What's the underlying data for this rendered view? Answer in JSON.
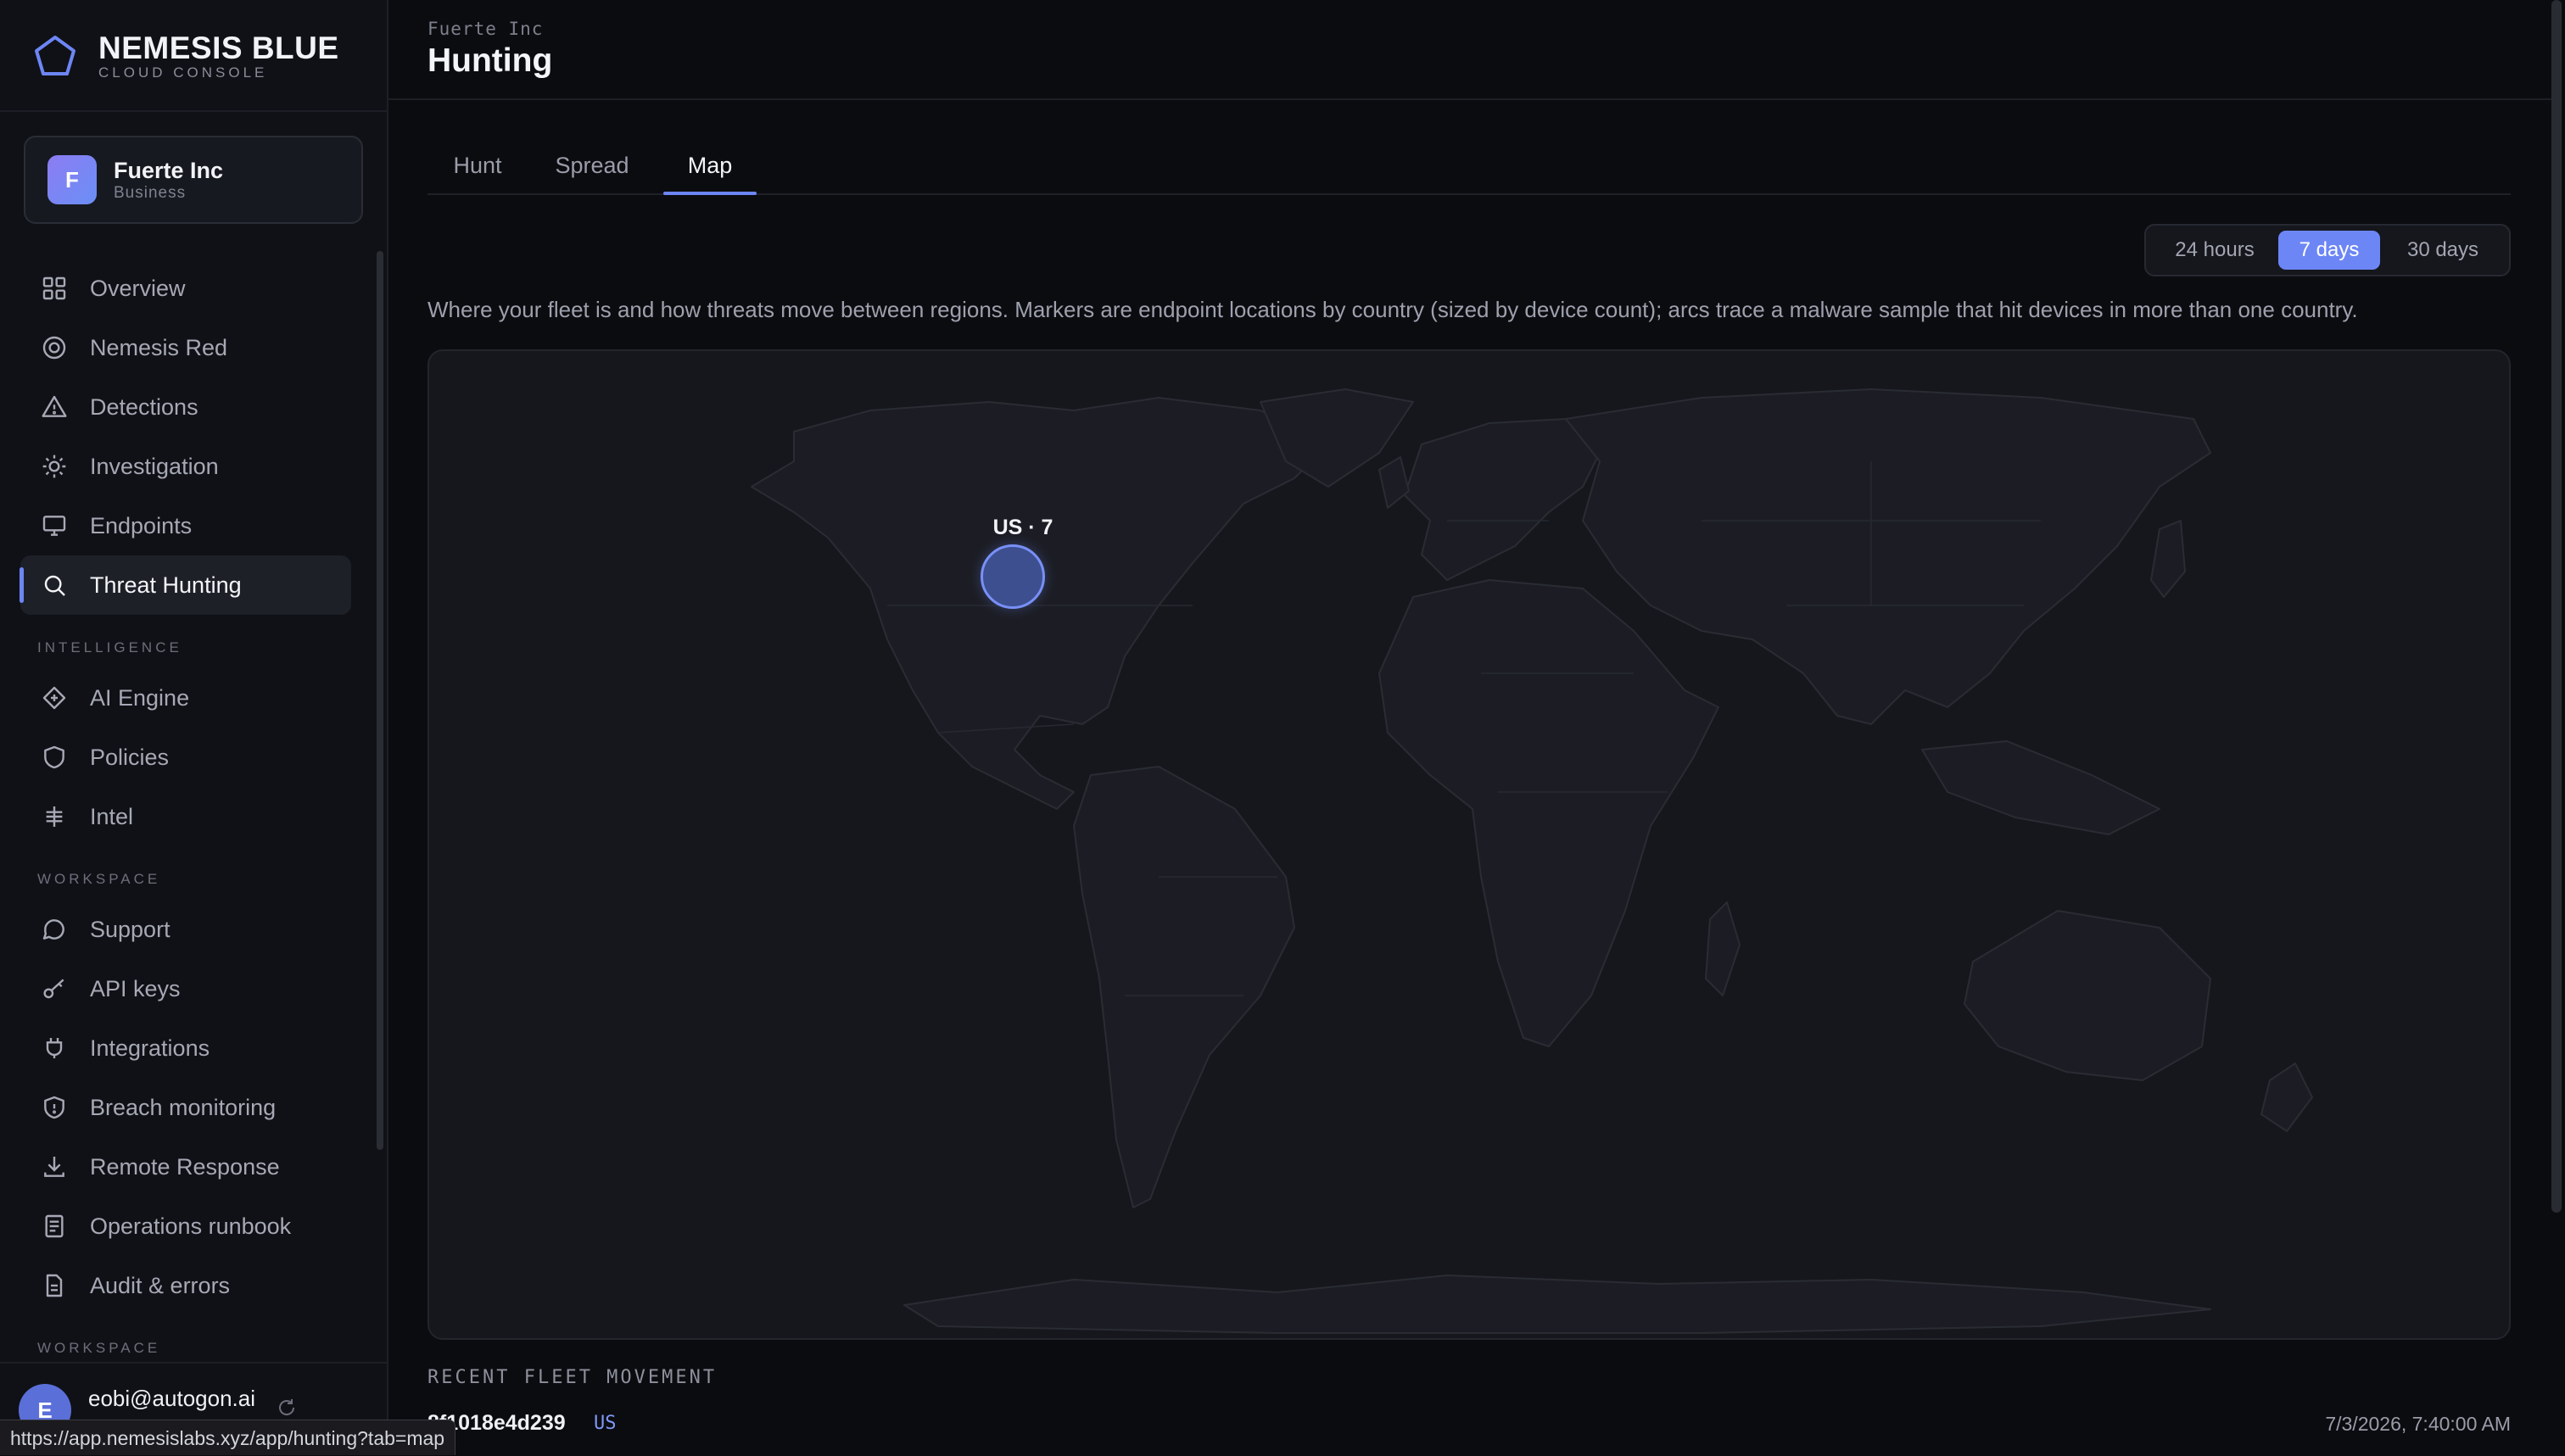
{
  "brand": {
    "name": "NEMESIS BLUE",
    "subtitle": "CLOUD CONSOLE"
  },
  "org": {
    "initial": "F",
    "name": "Fuerte Inc",
    "plan": "Business"
  },
  "nav": {
    "main": [
      {
        "label": "Overview",
        "icon": "grid-icon"
      },
      {
        "label": "Nemesis Red",
        "icon": "target-icon"
      },
      {
        "label": "Detections",
        "icon": "warning-triangle-icon"
      },
      {
        "label": "Investigation",
        "icon": "sun-bug-icon"
      },
      {
        "label": "Endpoints",
        "icon": "monitor-icon"
      },
      {
        "label": "Threat Hunting",
        "icon": "search-icon",
        "active": true
      }
    ],
    "intelligence_label": "INTELLIGENCE",
    "intelligence": [
      {
        "label": "AI Engine",
        "icon": "diamond-icon"
      },
      {
        "label": "Policies",
        "icon": "shield-icon"
      },
      {
        "label": "Intel",
        "icon": "hash-icon"
      }
    ],
    "workspace_label": "WORKSPACE",
    "workspace": [
      {
        "label": "Support",
        "icon": "chat-bubble-icon"
      },
      {
        "label": "API keys",
        "icon": "key-icon"
      },
      {
        "label": "Integrations",
        "icon": "plug-icon"
      },
      {
        "label": "Breach monitoring",
        "icon": "shield-alert-icon"
      },
      {
        "label": "Remote Response",
        "icon": "download-icon"
      },
      {
        "label": "Operations runbook",
        "icon": "book-icon"
      },
      {
        "label": "Audit & errors",
        "icon": "file-icon"
      }
    ],
    "workspace_label_2": "WORKSPACE"
  },
  "user": {
    "initial": "E",
    "email": "eobi@autogon.ai"
  },
  "status_url": "https://app.nemesislabs.xyz/app/hunting?tab=map",
  "header": {
    "breadcrumb": "Fuerte Inc",
    "title": "Hunting"
  },
  "tabs": [
    {
      "label": "Hunt"
    },
    {
      "label": "Spread"
    },
    {
      "label": "Map",
      "active": true
    }
  ],
  "time_range": {
    "options": [
      "24 hours",
      "7 days",
      "30 days"
    ],
    "selected": "7 days"
  },
  "description": "Where your fleet is and how threats move between regions. Markers are endpoint locations by country (sized by device count); arcs trace a malware sample that hit devices in more than one country.",
  "map": {
    "markers": [
      {
        "country": "US",
        "count": 7,
        "label": "US · 7"
      }
    ]
  },
  "recent_movement": {
    "title": "RECENT FLEET MOVEMENT",
    "rows": [
      {
        "hash": "8f1018e4d239",
        "country": "US",
        "timestamp": "7/3/2026, 7:40:00 AM"
      }
    ]
  },
  "colors": {
    "accent": "#6d86f5",
    "background": "#0b0c10",
    "sidebar": "#101116",
    "map_land": "#1c1d24"
  }
}
